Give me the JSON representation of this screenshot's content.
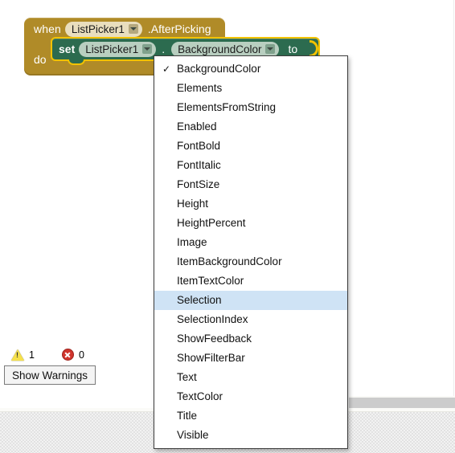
{
  "canvas": {
    "event_block": {
      "when_label": "when",
      "component": "ListPicker1",
      "event_name": ".AfterPicking",
      "do_label": "do",
      "color": "#B08B28"
    },
    "setter_block": {
      "set_label": "set",
      "component": "ListPicker1",
      "dot": ".",
      "property": "BackgroundColor",
      "to_label": "to",
      "color": "#2C6B4F",
      "selected_outline": "#F2C200"
    }
  },
  "status": {
    "warning_count": "1",
    "error_count": "0",
    "warning_icon": "warning-triangle-icon",
    "error_icon": "error-circle-icon",
    "show_warnings_label": "Show Warnings"
  },
  "property_menu": {
    "checked_item": "BackgroundColor",
    "highlighted_item": "Selection",
    "highlight_color": "#CFE3F5",
    "items": [
      {
        "label": "BackgroundColor",
        "checked": true,
        "highlighted": false
      },
      {
        "label": "Elements",
        "checked": false,
        "highlighted": false
      },
      {
        "label": "ElementsFromString",
        "checked": false,
        "highlighted": false
      },
      {
        "label": "Enabled",
        "checked": false,
        "highlighted": false
      },
      {
        "label": "FontBold",
        "checked": false,
        "highlighted": false
      },
      {
        "label": "FontItalic",
        "checked": false,
        "highlighted": false
      },
      {
        "label": "FontSize",
        "checked": false,
        "highlighted": false
      },
      {
        "label": "Height",
        "checked": false,
        "highlighted": false
      },
      {
        "label": "HeightPercent",
        "checked": false,
        "highlighted": false
      },
      {
        "label": "Image",
        "checked": false,
        "highlighted": false
      },
      {
        "label": "ItemBackgroundColor",
        "checked": false,
        "highlighted": false
      },
      {
        "label": "ItemTextColor",
        "checked": false,
        "highlighted": false
      },
      {
        "label": "Selection",
        "checked": false,
        "highlighted": true
      },
      {
        "label": "SelectionIndex",
        "checked": false,
        "highlighted": false
      },
      {
        "label": "ShowFeedback",
        "checked": false,
        "highlighted": false
      },
      {
        "label": "ShowFilterBar",
        "checked": false,
        "highlighted": false
      },
      {
        "label": "Text",
        "checked": false,
        "highlighted": false
      },
      {
        "label": "TextColor",
        "checked": false,
        "highlighted": false
      },
      {
        "label": "Title",
        "checked": false,
        "highlighted": false
      },
      {
        "label": "Visible",
        "checked": false,
        "highlighted": false
      }
    ],
    "check_glyph": "✓"
  }
}
